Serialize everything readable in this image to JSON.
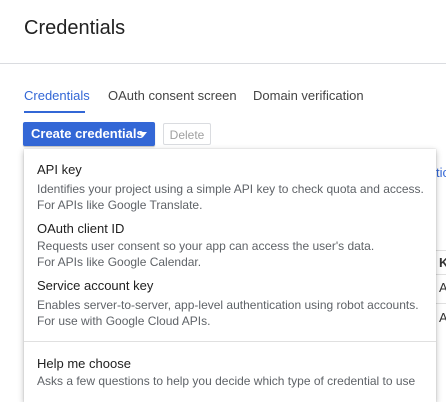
{
  "header": {
    "title": "Credentials"
  },
  "tabs": [
    {
      "label": "Credentials",
      "active": true
    },
    {
      "label": "OAuth consent screen",
      "active": false
    },
    {
      "label": "Domain verification",
      "active": false
    }
  ],
  "toolbar": {
    "create_label": "Create credentials",
    "delete_label": "Delete"
  },
  "background_fragments": {
    "link_tail": "tic",
    "column_head": "K",
    "row1": "A",
    "row2": "A"
  },
  "menu": {
    "items": [
      {
        "title": "API key",
        "desc_line1": "Identifies your project using a simple API key to check quota and access.",
        "desc_line2": "For APIs like Google Translate."
      },
      {
        "title": "OAuth client ID",
        "desc_line1": "Requests user consent so your app can access the user's data.",
        "desc_line2": "For APIs like Google Calendar."
      },
      {
        "title": "Service account key",
        "desc_line1": "Enables server-to-server, app-level authentication using robot accounts.",
        "desc_line2": "For use with Google Cloud APIs."
      },
      {
        "title": "Help me choose",
        "desc_line1": "Asks a few questions to help you decide which type of credential to use",
        "desc_line2": ""
      }
    ]
  },
  "colors": {
    "accent": "#3367d6",
    "text": "#212121",
    "muted": "#5f6368"
  }
}
